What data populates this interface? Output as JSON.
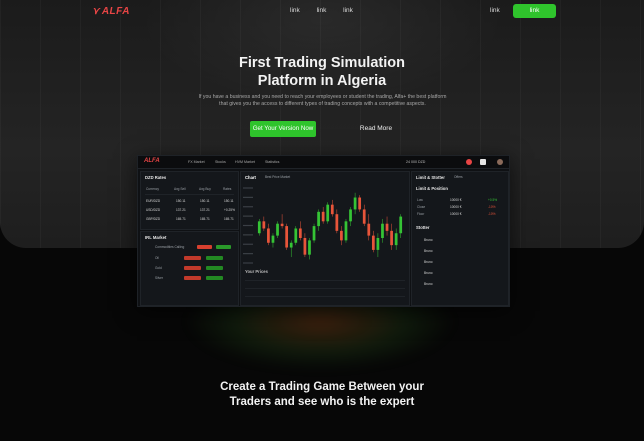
{
  "brand": {
    "logo_text": "ALFA"
  },
  "nav": {
    "links": [
      "link",
      "link",
      "link"
    ],
    "right_link": "link",
    "cta_label": "link"
  },
  "hero": {
    "headline_line1": "First Trading Simulation",
    "headline_line2": "Platform in Algeria",
    "subtext": "If you have a business and you need to reach your employees or student the trading, Alfa+ the best platform that gives you the access to different types of trading concepts with a competitive aspects.",
    "primary_button": "Get Your Version Now",
    "secondary_button": "Read More"
  },
  "dashboard": {
    "logo_text": "ALFA",
    "nav_items": [
      "FX Market",
      "Stocks",
      "HVM Market",
      "Statistics"
    ],
    "balance_text": "24 000 DZD",
    "rates_panel": {
      "title": "DZD Rates",
      "headers": [
        "Currency",
        "Avg Sell",
        "Avg Buy",
        "Rates"
      ],
      "rows": [
        [
          "EUR/DZD",
          "150.11",
          "150.11",
          "150.11"
        ],
        [
          "USD/DZD",
          "137.21",
          "137.21",
          "+0.25%"
        ],
        [
          "GBP/DZD",
          "165.71",
          "165.71",
          "165.71"
        ]
      ]
    },
    "market_panel": {
      "title": "IRL Market",
      "subtitle": "Commodities Calling",
      "sell_label": "Sell",
      "buy_label": "Buy",
      "rows": [
        {
          "name": "Oil",
          "sell": "Sell",
          "buy": "Buy"
        },
        {
          "name": "Gold",
          "sell": "Sell",
          "buy": "Buy"
        },
        {
          "name": "Silver",
          "sell": "Sell",
          "buy": "Buy"
        }
      ]
    },
    "chart_panel": {
      "tabs": [
        "Chart",
        "Best Price Market"
      ],
      "prices_title": "Your Prices"
    },
    "limit_panel": {
      "tabs": [
        "Limit & Stotter",
        "Offers"
      ],
      "section_title": "Limit & Position",
      "rows": [
        {
          "label": "Low",
          "value": "10000 €",
          "change": "+0.5%"
        },
        {
          "label": "Close",
          "value": "10000 €",
          "change": "-10%"
        },
        {
          "label": "Floor",
          "value": "10000 €",
          "change": "-10%"
        }
      ],
      "stotter_title": "Stotter",
      "stotter_rows": [
        "Bruno",
        "Bruno",
        "Bruno",
        "Bruno",
        "Bruno"
      ]
    }
  },
  "section2": {
    "line1": "Create a Trading Game Between your",
    "line2": "Traders and see who is the expert"
  },
  "colors": {
    "accent_green": "#2fc42c",
    "accent_red": "#e84545",
    "candle_up": "#35c435",
    "candle_down": "#e8553a"
  },
  "chart_data": {
    "type": "candlestick",
    "candles": [
      [
        50,
        62,
        48,
        60
      ],
      [
        60,
        64,
        52,
        54
      ],
      [
        54,
        58,
        40,
        42
      ],
      [
        42,
        50,
        38,
        48
      ],
      [
        48,
        60,
        46,
        58
      ],
      [
        58,
        66,
        54,
        56
      ],
      [
        56,
        58,
        36,
        38
      ],
      [
        38,
        44,
        30,
        42
      ],
      [
        42,
        56,
        40,
        54
      ],
      [
        54,
        60,
        44,
        46
      ],
      [
        46,
        50,
        30,
        32
      ],
      [
        32,
        46,
        28,
        44
      ],
      [
        44,
        58,
        42,
        56
      ],
      [
        56,
        70,
        52,
        68
      ],
      [
        68,
        72,
        58,
        60
      ],
      [
        60,
        76,
        58,
        74
      ],
      [
        74,
        78,
        64,
        66
      ],
      [
        66,
        70,
        50,
        52
      ],
      [
        52,
        56,
        40,
        44
      ],
      [
        44,
        62,
        42,
        60
      ],
      [
        60,
        72,
        56,
        70
      ],
      [
        70,
        84,
        66,
        80
      ],
      [
        80,
        82,
        68,
        70
      ],
      [
        70,
        74,
        56,
        58
      ],
      [
        58,
        66,
        44,
        48
      ],
      [
        48,
        52,
        34,
        36
      ],
      [
        36,
        50,
        30,
        46
      ],
      [
        46,
        62,
        42,
        58
      ],
      [
        58,
        64,
        48,
        52
      ],
      [
        52,
        58,
        36,
        40
      ],
      [
        40,
        54,
        36,
        50
      ],
      [
        50,
        66,
        46,
        64
      ]
    ]
  }
}
